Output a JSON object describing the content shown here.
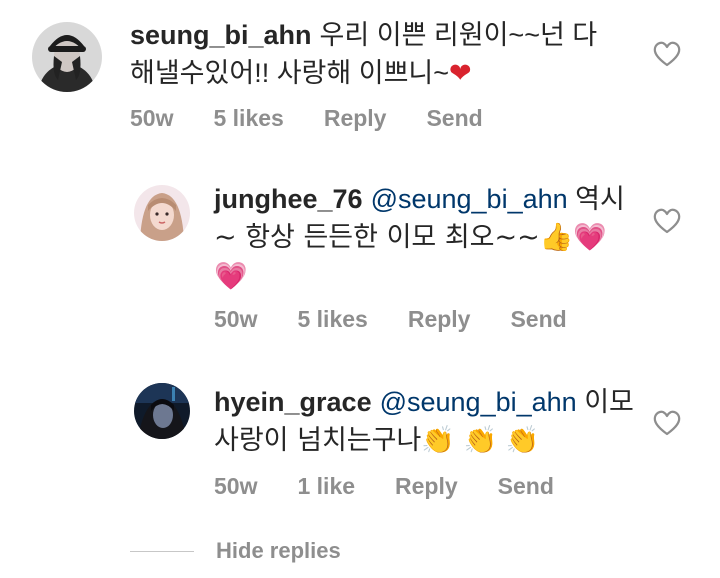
{
  "colors": {
    "username": "#262626",
    "mention": "#00376b",
    "meta": "#8e8e8e",
    "heart_outline": "#8e8e8e"
  },
  "comments": [
    {
      "username": "seung_bi_ahn",
      "mention": "",
      "line1": "우리 이쁜 리원이~~넌 다",
      "line2": "해낼수있어!! 사랑해 이쁘니~",
      "line3": "",
      "emoji": "❤",
      "age": "50w",
      "likes": "5 likes",
      "reply": "Reply",
      "send": "Send",
      "icon": "heart-outline-icon"
    },
    {
      "username": "junghee_76",
      "mention": "@seung_bi_ahn",
      "line1": "역시",
      "line2": "~ 항상 든든한 이모 최오~~👍💗",
      "line3": "💗",
      "age": "50w",
      "likes": "5 likes",
      "reply": "Reply",
      "send": "Send",
      "icon": "heart-outline-icon"
    },
    {
      "username": "hyein_grace",
      "mention": "@seung_bi_ahn",
      "line1": "이모",
      "line2": "사랑이 넘치는구나👏 👏 👏",
      "line3": "",
      "age": "50w",
      "likes": "1 like",
      "reply": "Reply",
      "send": "Send",
      "icon": "heart-outline-icon"
    }
  ],
  "hide_replies": "Hide replies"
}
